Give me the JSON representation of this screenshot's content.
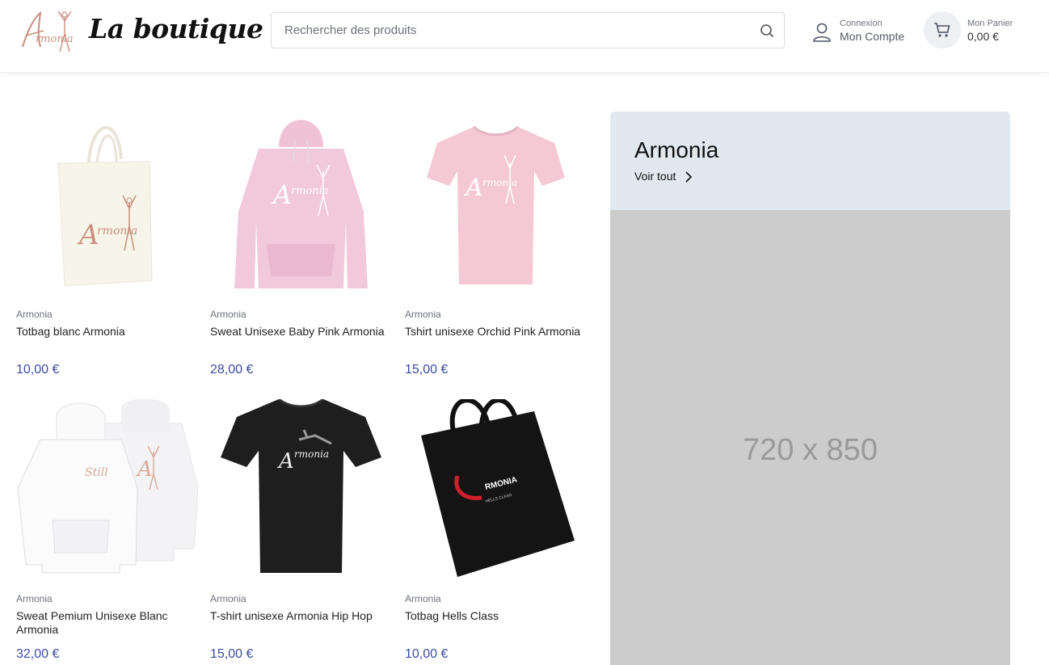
{
  "header": {
    "brand": "La boutique",
    "logo_text": "Armonia",
    "search": {
      "placeholder": "Rechercher des produits",
      "value": ""
    },
    "account": {
      "label_small": "Connexion",
      "label": "Mon Compte"
    },
    "cart": {
      "label_small": "Mon Panier",
      "total": "0,00 €"
    }
  },
  "products": [
    {
      "category": "Armonia",
      "name": "Totbag blanc Armonia",
      "price": "10,00 €",
      "image": "tote-bag-cream"
    },
    {
      "category": "Armonia",
      "name": "Sweat Unisexe Baby Pink Armonia",
      "price": "28,00 €",
      "image": "hoodie-pink"
    },
    {
      "category": "Armonia",
      "name": "Tshirt unisexe Orchid Pink Armonia",
      "price": "15,00 €",
      "image": "tshirt-pink"
    },
    {
      "category": "Armonia",
      "name": "Sweat Pemium Unisexe Blanc Armonia",
      "price": "32,00 €",
      "image": "hoodie-white"
    },
    {
      "category": "Armonia",
      "name": "T-shirt unisexe Armonia Hip Hop",
      "price": "15,00 €",
      "image": "tshirt-black"
    },
    {
      "category": "Armonia",
      "name": "Totbag Hells Class",
      "price": "10,00 €",
      "image": "tote-bag-black"
    }
  ],
  "promo": {
    "title": "Armonia",
    "link": "Voir tout",
    "placeholder": "720 x 850"
  },
  "colors": {
    "price": "#3d4ba3",
    "promo_bg": "#e1e8ef",
    "placeholder_bg": "#cccccc",
    "logo": "#c98f7e"
  }
}
